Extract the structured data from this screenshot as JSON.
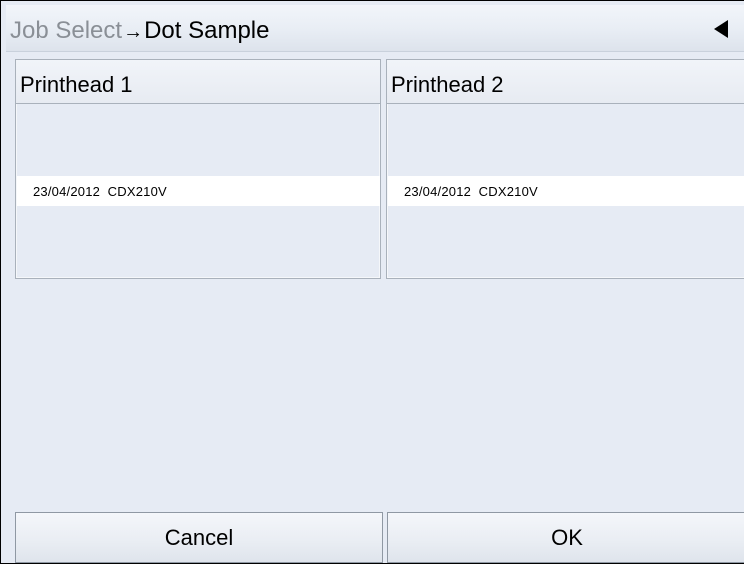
{
  "header": {
    "breadcrumb_parent": "Job Select",
    "breadcrumb_separator": "→",
    "breadcrumb_current": "Dot Sample",
    "back_icon": "triangle-left-icon"
  },
  "printheads": [
    {
      "title": "Printhead 1",
      "sample": "23/04/2012  CDX210V"
    },
    {
      "title": "Printhead 2",
      "sample": "23/04/2012  CDX210V"
    }
  ],
  "footer": {
    "cancel_label": "Cancel",
    "ok_label": "OK"
  },
  "colors": {
    "background": "#e6ebf4",
    "breadcrumb_parent": "#8a8f96",
    "selected_row": "#ffffff"
  }
}
